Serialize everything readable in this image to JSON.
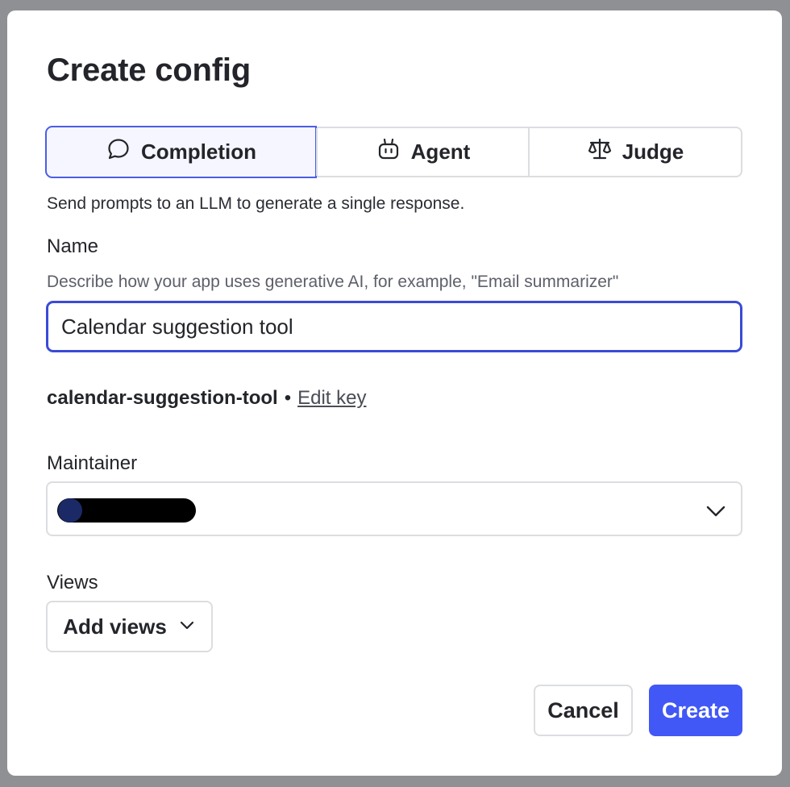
{
  "dialog": {
    "title": "Create config",
    "tabs": [
      {
        "label": "Completion",
        "icon": "chat-bubble-icon",
        "active": true
      },
      {
        "label": "Agent",
        "icon": "robot-icon",
        "active": false
      },
      {
        "label": "Judge",
        "icon": "scale-icon",
        "active": false
      }
    ],
    "description": "Send prompts to an LLM to generate a single response."
  },
  "name_field": {
    "label": "Name",
    "hint": "Describe how your app uses generative AI, for example, \"Email summarizer\"",
    "value": "Calendar suggestion tool"
  },
  "key": {
    "value": "calendar-suggestion-tool",
    "separator": "•",
    "edit_label": "Edit key"
  },
  "maintainer": {
    "label": "Maintainer",
    "icon": "chevron-down-icon"
  },
  "views": {
    "label": "Views",
    "button_label": "Add views",
    "icon": "chevron-down-icon"
  },
  "actions": {
    "cancel_label": "Cancel",
    "create_label": "Create"
  },
  "colors": {
    "accent": "#4158f6",
    "focus_border": "#3a4bd6",
    "active_tab_bg": "#f5f6ff"
  }
}
